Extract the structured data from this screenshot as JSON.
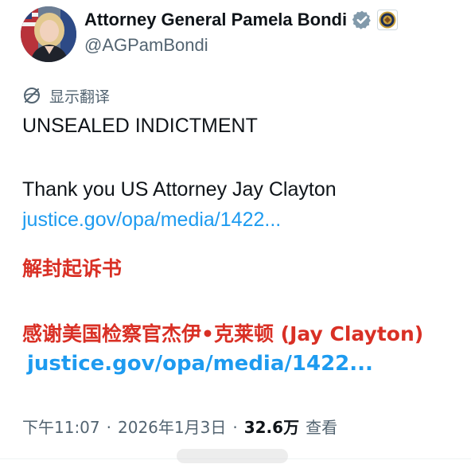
{
  "user": {
    "display_name": "Attorney General Pamela Bondi",
    "handle": "@AGPamBondi"
  },
  "translate": {
    "label": "显示翻译",
    "icon": "globe-slash-icon"
  },
  "post": {
    "line1": "UNSEALED INDICTMENT",
    "line2": "Thank you US Attorney Jay Clayton",
    "link1": "justice.gov/opa/media/1422...",
    "zh_line1": "解封起诉书",
    "zh_line2": "感谢美国检察官杰伊•克莱顿 (Jay Clayton)",
    "link2": "justice.gov/opa/media/1422..."
  },
  "meta": {
    "time": "下午11:07",
    "sep": "·",
    "date": "2026年1月3日",
    "views_count": "32.6万",
    "views_label": "查看"
  },
  "colors": {
    "link": "#1d9bf0",
    "translation_red": "#d93025",
    "secondary_text": "#536471",
    "verified_badge": "#829aab"
  }
}
